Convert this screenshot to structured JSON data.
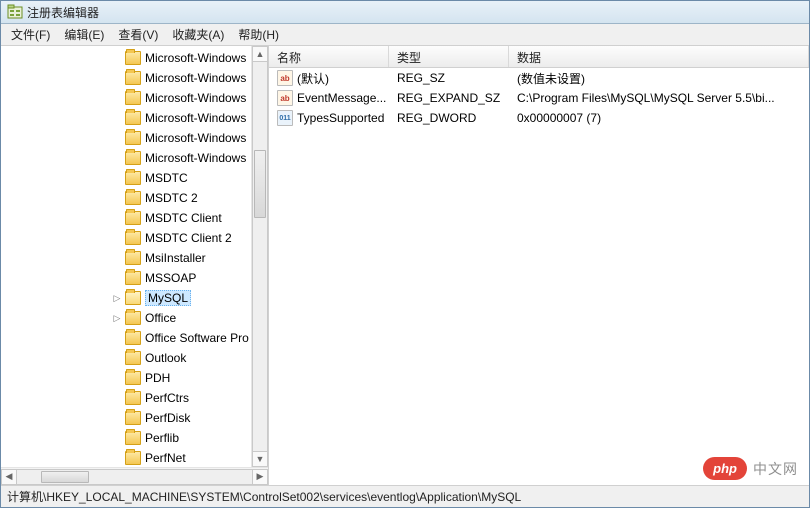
{
  "window": {
    "title": "注册表编辑器"
  },
  "menu": {
    "file": "文件(F)",
    "edit": "编辑(E)",
    "view": "查看(V)",
    "favorites": "收藏夹(A)",
    "help": "帮助(H)"
  },
  "tree": {
    "items": [
      {
        "label": "Microsoft-Windows",
        "truncated": true
      },
      {
        "label": "Microsoft-Windows",
        "truncated": true
      },
      {
        "label": "Microsoft-Windows",
        "truncated": true
      },
      {
        "label": "Microsoft-Windows",
        "truncated": true
      },
      {
        "label": "Microsoft-Windows",
        "truncated": true
      },
      {
        "label": "Microsoft-Windows",
        "truncated": true
      },
      {
        "label": "MSDTC"
      },
      {
        "label": "MSDTC 2"
      },
      {
        "label": "MSDTC Client"
      },
      {
        "label": "MSDTC Client 2"
      },
      {
        "label": "MsiInstaller"
      },
      {
        "label": "MSSOAP"
      },
      {
        "label": "MySQL",
        "selected": true,
        "expander": "right"
      },
      {
        "label": "Office",
        "expander": "right"
      },
      {
        "label": "Office Software Pro",
        "truncated": true
      },
      {
        "label": "Outlook"
      },
      {
        "label": "PDH"
      },
      {
        "label": "PerfCtrs"
      },
      {
        "label": "PerfDisk"
      },
      {
        "label": "Perflib"
      },
      {
        "label": "PerfNet"
      }
    ]
  },
  "list": {
    "headers": {
      "name": "名称",
      "type": "类型",
      "data": "数据"
    },
    "rows": [
      {
        "icon": "sz",
        "iconText": "ab",
        "name": "(默认)",
        "type": "REG_SZ",
        "data": "(数值未设置)"
      },
      {
        "icon": "sz",
        "iconText": "ab",
        "name": "EventMessage...",
        "type": "REG_EXPAND_SZ",
        "data": "C:\\Program Files\\MySQL\\MySQL Server 5.5\\bi..."
      },
      {
        "icon": "bin",
        "iconText": "011",
        "name": "TypesSupported",
        "type": "REG_DWORD",
        "data": "0x00000007 (7)"
      }
    ]
  },
  "statusbar": {
    "path": "计算机\\HKEY_LOCAL_MACHINE\\SYSTEM\\ControlSet002\\services\\eventlog\\Application\\MySQL"
  },
  "watermark": {
    "pill": "php",
    "text": "中文网"
  }
}
